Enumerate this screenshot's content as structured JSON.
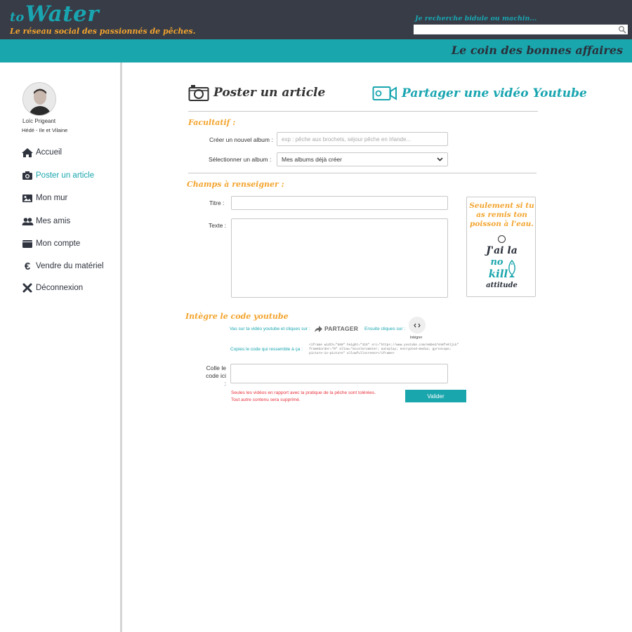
{
  "header": {
    "logo_prefix": "to",
    "logo_main": "Water",
    "tagline": "Le réseau social des passionnés de pêches.",
    "search_label": "Je recherche bidule ou machin...",
    "search_value": "",
    "section_title": "Le coin des bonnes affaires"
  },
  "profile": {
    "name": "Loïc Prigeant",
    "location": "Hédé - Ile et Vilaine"
  },
  "sidebar": {
    "items": [
      {
        "label": "Accueil",
        "icon": "home-icon"
      },
      {
        "label": "Poster un article",
        "icon": "camera-icon",
        "active": true
      },
      {
        "label": "Mon mur",
        "icon": "image-icon"
      },
      {
        "label": "Mes amis",
        "icon": "users-icon"
      },
      {
        "label": "Mon compte",
        "icon": "wallet-icon"
      },
      {
        "label": "Vendre du matériel",
        "icon": "euro-icon"
      },
      {
        "label": "Déconnexion",
        "icon": "close-icon"
      }
    ]
  },
  "tabs": {
    "post": "Poster un article",
    "video": "Partager une vidéo Youtube"
  },
  "optional": {
    "title": "Facultatif :",
    "create_album_label": "Créer un nouvel album :",
    "create_album_placeholder": "exp : pêche aux brochets, séjour pêche en Irlande...",
    "select_album_label": "Sélectionner un album :",
    "select_album_value": "Mes albums déjà créer"
  },
  "required": {
    "title": "Champs à renseigner :",
    "titre_label": "Titre :",
    "texte_label": "Texte :"
  },
  "promo": {
    "line_top": "Seulement si tu as remis ton poisson à l'eau.",
    "line1": "J'ai la",
    "line2": "no",
    "line3": "kill",
    "line4": "attitude"
  },
  "youtube": {
    "title": "Intègre le code youtube",
    "step1": "Vas sur ta vidéo youtube et cliques sur :",
    "share_label": "PARTAGER",
    "step2": "Ensuite cliques sur :",
    "embed_label": "Intégrer",
    "step3": "Copies le code qui ressemble à ça :",
    "code_sample": "<iframe width=\"560\" height=\"315\" src=\"https://www.youtube.com/embed/Vn8fv0ljLk\" frameborder=\"0\" allow=\"accelerometer; autoplay; encrypted-media; gyroscope; picture-in-picture\" allowfullscreen></iframe>",
    "paste_label": "Colle le code ici :",
    "warning_line1": "Seules les vidéos en rapport avec la pratique de la pêche sont tolérées.",
    "warning_line2": "Tout autre contenu sera supprimé.",
    "submit": "Valider"
  },
  "colors": {
    "brand_teal": "#1aa6ad",
    "accent_orange": "#f3a42e",
    "header_dark": "#373c47",
    "warning_red": "#e8323c"
  }
}
